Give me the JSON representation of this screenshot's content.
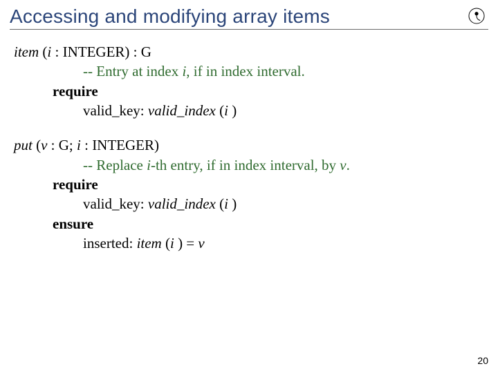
{
  "title": "Accessing and modifying array items",
  "logo_name": "eth-circle-icon",
  "item": {
    "sig_pre": "item",
    "sig_open": " (",
    "sig_param": "i ",
    "sig_type": ": INTEGER",
    "sig_close": ") : G",
    "comment_pre": "-- Entry at index ",
    "comment_i": "i",
    "comment_post": ", if in index interval.",
    "require": "require",
    "req_label": "valid_key: ",
    "req_call": "valid_index",
    "req_open": " (",
    "req_arg": "i ",
    "req_close": ")"
  },
  "put": {
    "sig_pre": "put",
    "sig_open": " (",
    "sig_v": "v ",
    "sig_vtype": ": G",
    "sig_sep": "; ",
    "sig_i": "i ",
    "sig_itype": ": INTEGER",
    "sig_close": ")",
    "comment_pre": "-- Replace ",
    "comment_i": "i",
    "comment_mid": "-th entry, if in index interval, by ",
    "comment_v": "v",
    "comment_post": ".",
    "require": "require",
    "req_label": "valid_key: ",
    "req_call": "valid_index",
    "req_open": " (",
    "req_arg": "i ",
    "req_close": ")",
    "ensure": "ensure",
    "ens_label": "inserted: ",
    "ens_call": "item",
    "ens_open": " (",
    "ens_arg": "i ",
    "ens_close": ") = ",
    "ens_v": "v"
  },
  "page_number": "20"
}
